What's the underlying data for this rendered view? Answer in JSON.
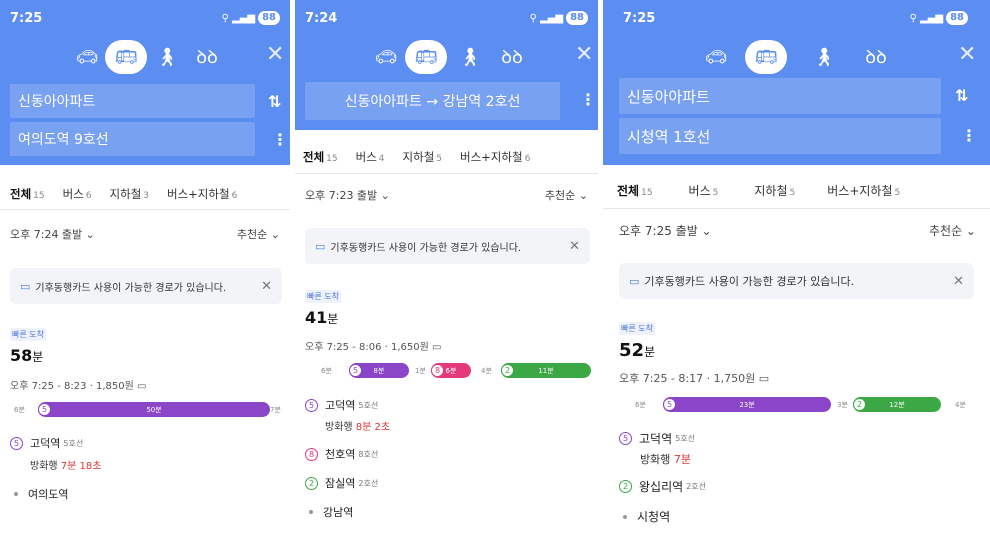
{
  "colors": {
    "header_blue": "#5c8df0",
    "line5": "#8a45c9",
    "line8": "#e4397a",
    "line2": "#3ba845",
    "warn_red": "#e03535"
  },
  "icons": [
    "car-icon",
    "bus-icon",
    "walk-icon",
    "bike-icon",
    "close-icon",
    "swap-icon",
    "more-vertical-icon",
    "card-icon",
    "dropdown-icon"
  ],
  "screens": [
    {
      "time": "7:25",
      "battery": "88",
      "origin": "신동아아파트",
      "destination": "여의도역 9호선",
      "tabs": [
        {
          "label": "전체",
          "count": "15"
        },
        {
          "label": "버스",
          "count": "6"
        },
        {
          "label": "지하철",
          "count": "3"
        },
        {
          "label": "버스+지하철",
          "count": "6"
        }
      ],
      "depart": "오후 7:24 출발 ⌄",
      "sort": "추천순 ⌄",
      "banner": "기후동행카드 사용이 가능한 경로가 있습니다.",
      "badge": "빠른 도착",
      "duration": "58",
      "duration_unit": "분",
      "meta": "오후 7:25 - 8:23 · 1,850원",
      "bar": {
        "walk_start": "6분",
        "segs": [
          {
            "line": "5",
            "label": "50분",
            "color": "#8a45c9"
          }
        ],
        "walk_end": "7분"
      },
      "steps": [
        {
          "line": "5",
          "color": "#8a45c9",
          "station": "고덕역",
          "line_name": "5호선",
          "sub_prefix": "방화행 ",
          "sub_red": "7분 18초"
        }
      ],
      "dest": "여의도역"
    },
    {
      "time": "7:24",
      "battery": "88",
      "route_title": "신동아아파트 → 강남역 2호선",
      "tabs": [
        {
          "label": "전체",
          "count": "15"
        },
        {
          "label": "버스",
          "count": "4"
        },
        {
          "label": "지하철",
          "count": "5"
        },
        {
          "label": "버스+지하철",
          "count": "6"
        }
      ],
      "depart": "오후 7:23 출발 ⌄",
      "sort": "추천순 ⌄",
      "banner": "기후동행카드 사용이 가능한 경로가 있습니다.",
      "badge": "빠른 도착",
      "duration": "41",
      "duration_unit": "분",
      "meta": "오후 7:25 - 8:06 · 1,650원",
      "bar": {
        "walk_start": "6분",
        "segs": [
          {
            "line": "5",
            "label": "8분",
            "color": "#8a45c9"
          },
          {
            "walk": "1분"
          },
          {
            "line": "8",
            "label": "6분",
            "color": "#e4397a"
          },
          {
            "walk": "4분"
          },
          {
            "line": "2",
            "label": "11분",
            "color": "#3ba845"
          }
        ]
      },
      "steps": [
        {
          "line": "5",
          "color": "#8a45c9",
          "station": "고덕역",
          "line_name": "5호선",
          "sub_prefix": "방화행 ",
          "sub_red": "8분 2초"
        },
        {
          "line": "8",
          "color": "#e4397a",
          "station": "천호역",
          "line_name": "8호선"
        },
        {
          "line": "2",
          "color": "#3ba845",
          "station": "잠실역",
          "line_name": "2호선"
        }
      ],
      "dest": "강남역"
    },
    {
      "time": "7:25",
      "battery": "88",
      "origin": "신동아아파트",
      "destination": "시청역 1호선",
      "tabs": [
        {
          "label": "전체",
          "count": "15"
        },
        {
          "label": "버스",
          "count": "5"
        },
        {
          "label": "지하철",
          "count": "5"
        },
        {
          "label": "버스+지하철",
          "count": "5"
        }
      ],
      "depart": "오후 7:25 출발 ⌄",
      "sort": "추천순 ⌄",
      "banner": "기후동행카드 사용이 가능한 경로가 있습니다.",
      "badge": "빠른 도착",
      "duration": "52",
      "duration_unit": "분",
      "meta": "오후 7:25 - 8:17 · 1,750원",
      "bar": {
        "walk_start": "6분",
        "segs": [
          {
            "line": "5",
            "label": "23분",
            "color": "#8a45c9"
          },
          {
            "walk": "3분"
          },
          {
            "line": "2",
            "label": "12분",
            "color": "#3ba845"
          }
        ],
        "walk_end": "4분"
      },
      "steps": [
        {
          "line": "5",
          "color": "#8a45c9",
          "station": "고덕역",
          "line_name": "5호선",
          "sub_prefix": "방화행 ",
          "sub_red": "7분"
        },
        {
          "line": "2",
          "color": "#3ba845",
          "station": "왕십리역",
          "line_name": "2호선"
        }
      ],
      "dest": "시청역"
    }
  ]
}
